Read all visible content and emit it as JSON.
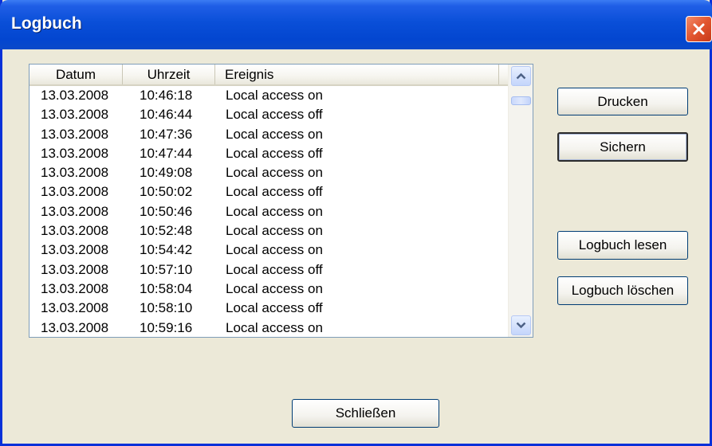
{
  "window": {
    "title": "Logbuch"
  },
  "list": {
    "columns": [
      "Datum",
      "Uhrzeit",
      "Ereignis"
    ],
    "rows": [
      [
        "13.03.2008",
        "10:46:18",
        "Local access on"
      ],
      [
        "13.03.2008",
        "10:46:44",
        "Local access off"
      ],
      [
        "13.03.2008",
        "10:47:36",
        "Local access on"
      ],
      [
        "13.03.2008",
        "10:47:44",
        "Local access off"
      ],
      [
        "13.03.2008",
        "10:49:08",
        "Local access on"
      ],
      [
        "13.03.2008",
        "10:50:02",
        "Local access off"
      ],
      [
        "13.03.2008",
        "10:50:46",
        "Local access on"
      ],
      [
        "13.03.2008",
        "10:52:48",
        "Local access on"
      ],
      [
        "13.03.2008",
        "10:54:42",
        "Local access on"
      ],
      [
        "13.03.2008",
        "10:57:10",
        "Local access off"
      ],
      [
        "13.03.2008",
        "10:58:04",
        "Local access on"
      ],
      [
        "13.03.2008",
        "10:58:10",
        "Local access off"
      ],
      [
        "13.03.2008",
        "10:59:16",
        "Local access on"
      ]
    ]
  },
  "buttons": {
    "print": "Drucken",
    "save": "Sichern",
    "read_log": "Logbuch lesen",
    "clear_log": "Logbuch löschen",
    "close": "Schließen"
  },
  "icons": {
    "close": "close-icon",
    "scroll_up": "chevron-up-icon",
    "scroll_down": "chevron-down-icon"
  },
  "colors": {
    "titlebar": "#0a4fd8",
    "close_button": "#e2552e",
    "dialog_background": "#ece9d8"
  }
}
